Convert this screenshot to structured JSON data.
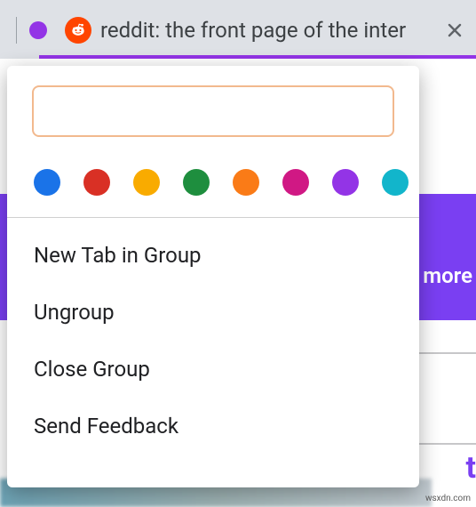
{
  "colors": {
    "group_current": "#9334e6",
    "group_underline": "#9334e6",
    "purple_band": "#7a3ff2",
    "favicon_bg": "#ff4500",
    "input_border": "#f2b98e",
    "blue": "#1a73e8",
    "red": "#d93025",
    "yellow": "#f9ab00",
    "green": "#1e8e3e",
    "orange": "#fa7b17",
    "pink": "#d01884",
    "purple": "#9334e6",
    "cyan": "#12b5cb"
  },
  "tab": {
    "title": "reddit: the front page of the inter"
  },
  "group_name_input": {
    "value": "",
    "placeholder": ""
  },
  "color_options": [
    {
      "name": "blue",
      "hex": "#1a73e8"
    },
    {
      "name": "red",
      "hex": "#d93025"
    },
    {
      "name": "yellow",
      "hex": "#f9ab00"
    },
    {
      "name": "green",
      "hex": "#1e8e3e"
    },
    {
      "name": "orange",
      "hex": "#fa7b17"
    },
    {
      "name": "pink",
      "hex": "#d01884"
    },
    {
      "name": "purple",
      "hex": "#9334e6"
    },
    {
      "name": "cyan",
      "hex": "#12b5cb"
    }
  ],
  "menu": {
    "new_tab_in_group": "New Tab in Group",
    "ungroup": "Ungroup",
    "close_group": "Close Group",
    "send_feedback": "Send Feedback"
  },
  "background": {
    "more_label": "more",
    "corner_letter": "t",
    "watermark": "wsxdn.com"
  }
}
